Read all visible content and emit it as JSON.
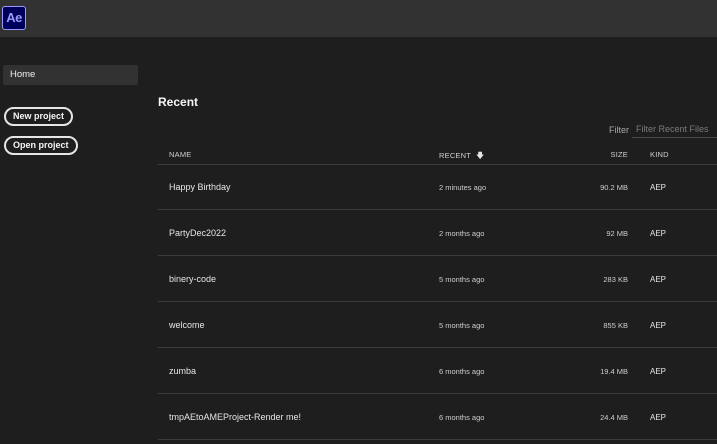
{
  "app": {
    "logo_text": "Ae"
  },
  "sidebar": {
    "home_label": "Home",
    "new_project_label": "New project",
    "open_project_label": "Open project"
  },
  "main": {
    "title": "Recent",
    "filter_label": "Filter",
    "filter_placeholder": "Filter Recent Files",
    "filter_value": "",
    "columns": {
      "name": "NAME",
      "recent": "RECENT",
      "recent_sort_icon": "arrow-down-icon",
      "size": "SIZE",
      "kind": "KIND"
    },
    "files": [
      {
        "name": "Happy Birthday",
        "recent": "2 minutes ago",
        "size": "90.2 MB",
        "kind": "AEP"
      },
      {
        "name": "PartyDec2022",
        "recent": "2 months ago",
        "size": "92 MB",
        "kind": "AEP"
      },
      {
        "name": "binery-code",
        "recent": "5 months ago",
        "size": "283 KB",
        "kind": "AEP"
      },
      {
        "name": "welcome",
        "recent": "5 months ago",
        "size": "855 KB",
        "kind": "AEP"
      },
      {
        "name": "zumba",
        "recent": "6 months ago",
        "size": "19.4 MB",
        "kind": "AEP"
      },
      {
        "name": "tmpAEtoAMEProject-Render me!",
        "recent": "6 months ago",
        "size": "24.4 MB",
        "kind": "AEP"
      }
    ]
  },
  "colors": {
    "background": "#1e1e1e",
    "topbar": "#323232",
    "ae_brand_bg": "#00005b",
    "ae_brand_fg": "#9999ff",
    "row_divider": "#3c3c3c"
  }
}
